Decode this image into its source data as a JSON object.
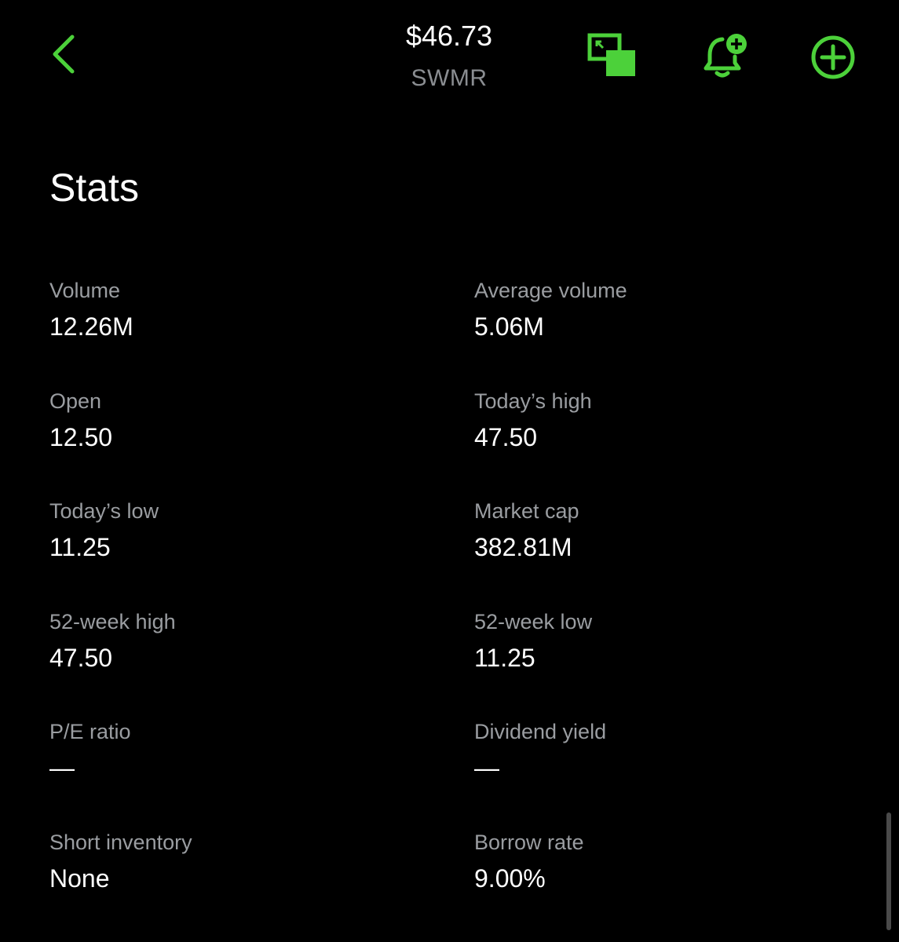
{
  "theme": {
    "accent": "#4cd13a",
    "background": "#000000",
    "text_primary": "#ffffff",
    "text_secondary": "#9a9da1"
  },
  "header": {
    "price": "$46.73",
    "ticker": "SWMR",
    "icons": {
      "back": "chevron-left-icon",
      "pip": "picture-in-picture-icon",
      "alert": "bell-plus-icon",
      "add": "circle-plus-icon"
    }
  },
  "stats": {
    "title": "Stats",
    "items": [
      {
        "label": "Volume",
        "value": "12.26M"
      },
      {
        "label": "Average volume",
        "value": "5.06M"
      },
      {
        "label": "Open",
        "value": "12.50"
      },
      {
        "label": "Today’s high",
        "value": "47.50"
      },
      {
        "label": "Today’s low",
        "value": "11.25"
      },
      {
        "label": "Market cap",
        "value": "382.81M"
      },
      {
        "label": "52-week high",
        "value": "47.50"
      },
      {
        "label": "52-week low",
        "value": "11.25"
      },
      {
        "label": "P/E ratio",
        "value": "—"
      },
      {
        "label": "Dividend yield",
        "value": "—"
      },
      {
        "label": "Short inventory",
        "value": "None"
      },
      {
        "label": "Borrow rate",
        "value": "9.00%"
      }
    ]
  }
}
